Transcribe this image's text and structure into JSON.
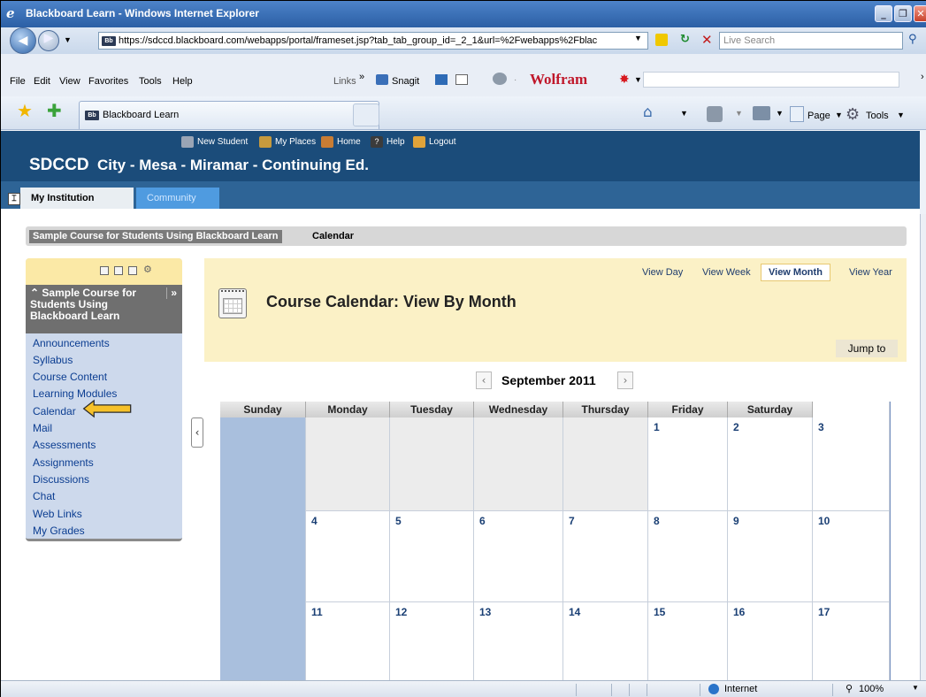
{
  "window": {
    "title": "Blackboard Learn - Windows Internet Explorer",
    "controls": {
      "minimize": "_",
      "restore": "❐",
      "close": "✕"
    }
  },
  "address_bar": {
    "url": "https://sdccd.blackboard.com/webapps/portal/frameset.jsp?tab_tab_group_id=_2_1&url=%2Fwebapps%2Fblac",
    "search_placeholder": "Live Search"
  },
  "menu": [
    "File",
    "Edit",
    "View",
    "Favorites",
    "Tools",
    "Help"
  ],
  "toolbar": {
    "links_label": "Links",
    "snagit_label": "Snagit",
    "wolfram_label": "Wolfram"
  },
  "browser_tab": {
    "label": "Blackboard Learn",
    "favicon_text": "Bb"
  },
  "command_bar": {
    "page_label": "Page",
    "tools_label": "Tools"
  },
  "bb_header": {
    "top_links": [
      "New Student",
      "My Places",
      "Home",
      "Help",
      "Logout"
    ],
    "institution": "SDCCD",
    "institution_sub": "City - Mesa - Miramar - Continuing Ed.",
    "tabs": [
      "My Institution",
      "Community"
    ]
  },
  "breadcrumb": {
    "course": "Sample Course for Students Using Blackboard Learn",
    "current": "Calendar"
  },
  "course_menu": {
    "title": "Sample Course for Students Using Blackboard Learn",
    "items": [
      "Announcements",
      "Syllabus",
      "Course Content",
      "Learning Modules",
      "Calendar",
      "Mail",
      "Assessments",
      "Assignments",
      "Discussions",
      "Chat",
      "Web Links",
      "My Grades"
    ]
  },
  "calendar": {
    "view_links": [
      "View Day",
      "View Week",
      "View Month",
      "View Year"
    ],
    "active_view": "View Month",
    "title": "Course Calendar: View By Month",
    "jump_label": "Jump to",
    "month_label": "September 2011",
    "weekdays": [
      "Sunday",
      "Monday",
      "Tuesday",
      "Wednesday",
      "Thursday",
      "Friday",
      "Saturday"
    ],
    "weeks": [
      [
        "",
        "",
        "",
        "",
        "1",
        "2",
        "3"
      ],
      [
        "",
        "4",
        "5",
        "6",
        "7",
        "8",
        "9",
        "10"
      ],
      [
        "",
        "11",
        "12",
        "13",
        "14",
        "15",
        "16",
        "17"
      ]
    ]
  },
  "status_bar": {
    "zone": "Internet",
    "zoom": "100%"
  }
}
